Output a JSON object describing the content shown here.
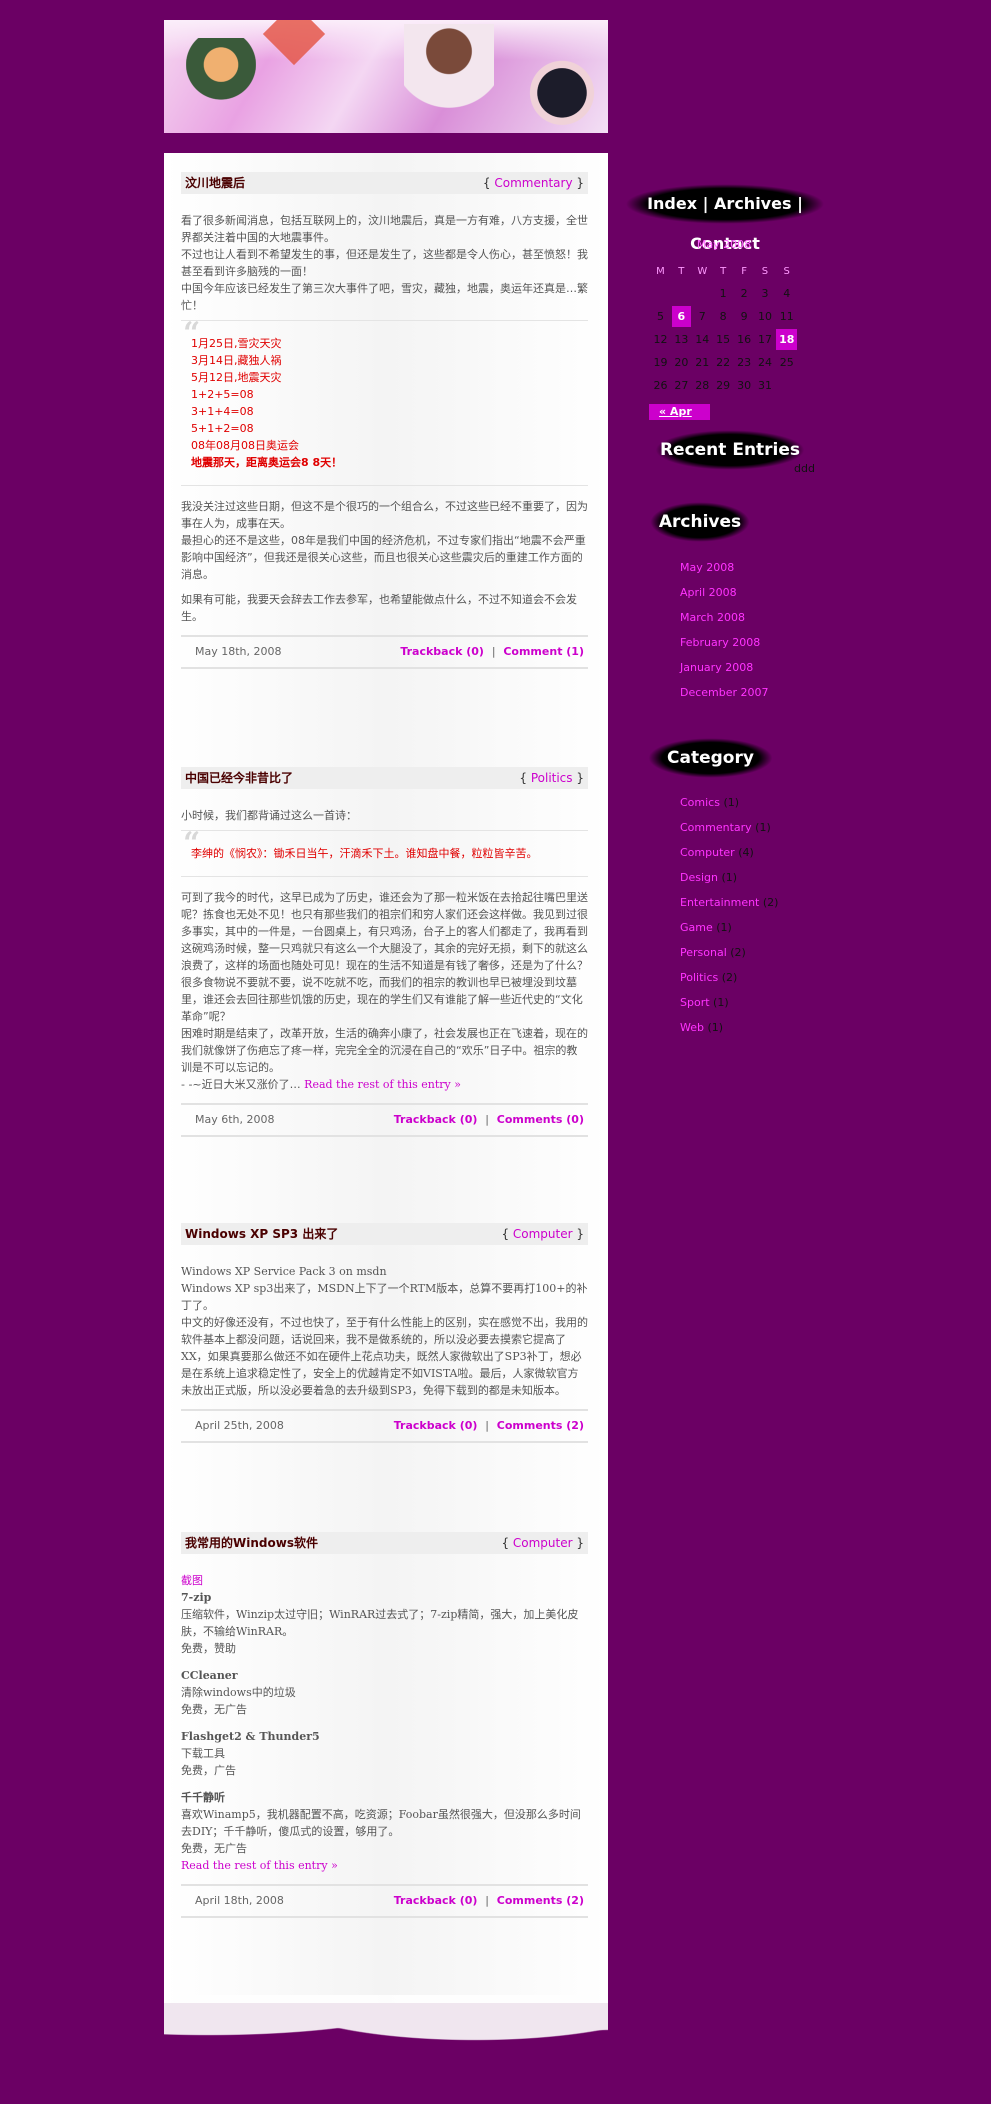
{
  "banner": {
    "alt": "anime-style header illustration"
  },
  "posts": [
    {
      "title": "汶川地震后",
      "category": "Commentary",
      "intro": [
        "看了很多新闻消息，包括互联网上的，汶川地震后，真是一方有难，八方支援，全世界都关注着中国的大地震事件。",
        "不过也让人看到不希望发生的事，但还是发生了，这些都是令人伤心，甚至愤怒！我甚至看到许多脑残的一面！",
        "中国今年应该已经发生了第三次大事件了吧，雪灾，藏独，地震，奥运年还真是…繁忙！"
      ],
      "quote": [
        "1月25日,雪灾天灾",
        "3月14日,藏独人祸",
        "5月12日,地震天灾",
        "1+2+5=08",
        "3+1+4=08",
        "5+1+2=08",
        "08年08月08日奥运会",
        "地震那天，距离奥运会8 8天！"
      ],
      "outro": [
        "我没关注过这些日期，但这不是个很巧的一个组合么，不过这些已经不重要了，因为事在人为，成事在天。",
        "最担心的还不是这些，08年是我们中国的经济危机，不过专家们指出“地震不会严重影响中国经济”，但我还是很关心这些，而且也很关心这些震灾后的重建工作方面的消息。",
        "如果有可能，我要天会辞去工作去参军，也希望能做点什么，不过不知道会不会发生。"
      ],
      "date": "May 18th, 2008",
      "trackback": "Trackback (0)",
      "sep": "|",
      "comments": "Comment (1)"
    },
    {
      "title": "中国已经今非昔比了",
      "category": "Politics",
      "intro": "小时候，我们都背诵过这么一首诗：",
      "quote": "李绅的《悯农》：锄禾日当午，汗滴禾下土。谁知盘中餐，粒粒皆辛苦。",
      "body": [
        "可到了我今的时代，这早已成为了历史，谁还会为了那一粒米饭在去拾起往嘴巴里送呢？拣食也无处不见！也只有那些我们的祖宗们和穷人家们还会这样做。我见到过很多事实，其中的一件是，一台圆桌上，有只鸡汤，台子上的客人们都走了，我再看到这碗鸡汤时候，整一只鸡就只有这么一个大腿没了，其余的完好无损，剩下的就这么浪费了，这样的场面也随处可见！现在的生活不知道是有钱了奢侈，还是为了什么？很多食物说不要就不要，说不吃就不吃，而我们的祖宗的教训也早已被埋没到坟墓里，谁还会去回往那些饥饿的历史，现在的学生们又有谁能了解一些近代史的“文化革命”呢？",
        "困难时期是结束了，改革开放，生活的确奔小康了，社会发展也正在飞速着，现在的我们就像饼了伤疤忘了疼一样，完完全全的沉浸在自己的“欢乐”日子中。祖宗的教训是不可以忘记的。",
        "- -~近日大米又涨价了…"
      ],
      "more": "Read the rest of this entry »",
      "date": "May 6th, 2008",
      "trackback": "Trackback (0)",
      "sep": "|",
      "comments": "Comments (0)"
    },
    {
      "title": "Windows XP SP3 出来了",
      "category": "Computer",
      "body": [
        "Windows XP Service Pack 3 on msdn",
        "Windows XP sp3出来了，MSDN上下了一个RTM版本，总算不要再打100+的补丁了。",
        "中文的好像还没有，不过也快了，至于有什么性能上的区别，实在感觉不出，我用的软件基本上都没问题，话说回来，我不是做系统的，所以没必要去摸索它提高了XX，如果真要那么做还不如在硬件上花点功夫，既然人家微软出了SP3补丁，想必是在系统上追求稳定性了，安全上的优越肯定不如VISTA啦。最后，人家微软官方未放出正式版，所以没必要着急的去升级到SP3，免得下载到的都是未知版本。"
      ],
      "date": "April 25th, 2008",
      "trackback": "Trackback (0)",
      "sep": "|",
      "comments": "Comments (2)"
    },
    {
      "title": "我常用的Windows软件",
      "category": "Computer",
      "link": "截图",
      "soft": [
        {
          "name": "7-zip",
          "desc": "压缩软件，Winzip太过守旧；WinRAR过去式了；7-zip精简，强大，加上美化皮肤，不输给WinRAR。",
          "license": "免费，赞助"
        },
        {
          "name": "CCleaner",
          "desc": "清除windows中的垃圾",
          "license": "免费，无广告"
        },
        {
          "name": "Flashget2 & Thunder5",
          "desc": "下载工具",
          "license": "免费，广告"
        },
        {
          "name": "千千静听",
          "desc": "喜欢Winamp5，我机器配置不高，吃资源；Foobar虽然很强大，但没那么多时间去DIY；千千静听，傻瓜式的设置，够用了。",
          "license": "免费，无广告"
        }
      ],
      "more": "Read the rest of this entry »",
      "date": "April 18th, 2008",
      "trackback": "Trackback (0)",
      "sep": "|",
      "comments": "Comments (2)"
    }
  ],
  "sidebar": {
    "nav": [
      "Index",
      "Archives",
      "Contact"
    ],
    "nav_sep": "|",
    "calendar": {
      "caption": "May 2008",
      "weekdays": [
        "M",
        "T",
        "W",
        "T",
        "F",
        "S",
        "S"
      ],
      "weeks": [
        [
          "",
          "",
          "",
          "1",
          "2",
          "3",
          "4"
        ],
        [
          "5",
          "6",
          "7",
          "8",
          "9",
          "10",
          "11"
        ],
        [
          "12",
          "13",
          "14",
          "15",
          "16",
          "17",
          "18"
        ],
        [
          "19",
          "20",
          "21",
          "22",
          "23",
          "24",
          "25"
        ],
        [
          "26",
          "27",
          "28",
          "29",
          "30",
          "31",
          ""
        ]
      ],
      "highlighted": [
        "6",
        "18"
      ],
      "prev": "« Apr"
    },
    "recent_heading": "Recent Entries",
    "recent_text": "ddd",
    "archives_heading": "Archives",
    "archives": [
      "May 2008",
      "April 2008",
      "March 2008",
      "February 2008",
      "January 2008",
      "December 2007"
    ],
    "category_heading": "Category",
    "categories": [
      {
        "name": "Comics",
        "count": "(1)"
      },
      {
        "name": "Commentary",
        "count": "(1)"
      },
      {
        "name": "Computer",
        "count": "(4)"
      },
      {
        "name": "Design",
        "count": "(1)"
      },
      {
        "name": "Entertainment",
        "count": "(2)"
      },
      {
        "name": "Game",
        "count": "(1)"
      },
      {
        "name": "Personal",
        "count": "(2)"
      },
      {
        "name": "Politics",
        "count": "(2)"
      },
      {
        "name": "Sport",
        "count": "(1)"
      },
      {
        "name": "Web",
        "count": "(1)"
      }
    ]
  }
}
